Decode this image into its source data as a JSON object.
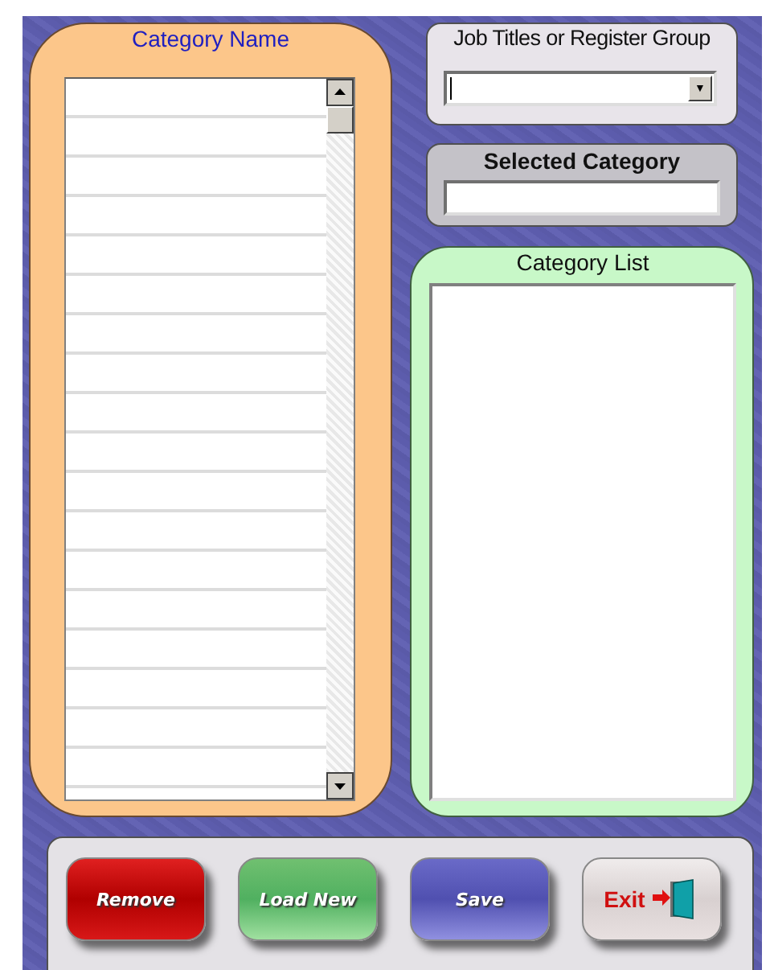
{
  "category_name_panel": {
    "title": "Category Name"
  },
  "job_titles_panel": {
    "title": "Job Titles or Register Group",
    "dropdown": {
      "caret": "▼"
    }
  },
  "selected_category_panel": {
    "title": "Selected Category"
  },
  "category_list_panel": {
    "title": "Category List"
  },
  "buttons": [
    {
      "label": "Remove",
      "kind": "remove"
    },
    {
      "label": "Load New",
      "kind": "load"
    },
    {
      "label": "Save",
      "kind": "save"
    },
    {
      "label": "Exit",
      "kind": "exit"
    }
  ]
}
